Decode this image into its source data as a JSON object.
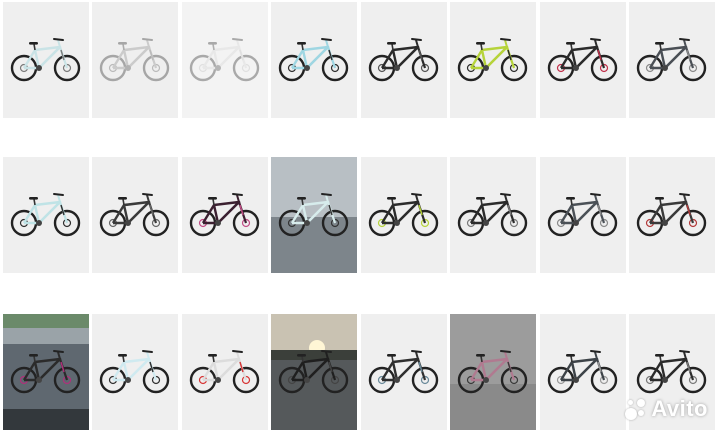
{
  "gallery": {
    "columns": 8,
    "rows": 3,
    "tiles": [
      {
        "bg": "#efefef",
        "frame": "#c9e3e6",
        "accent": "#7a7a7a",
        "faded": false,
        "scene": "studio"
      },
      {
        "bg": "#efefef",
        "frame": "#8a8a8a",
        "accent": "#5a5a5a",
        "faded": true,
        "scene": "studio"
      },
      {
        "bg": "#f3f3f3",
        "frame": "#d6d6d6",
        "accent": "#bdbdbd",
        "faded": true,
        "scene": "studio"
      },
      {
        "bg": "#efefef",
        "frame": "#9fd6e2",
        "accent": "#2f2f2f",
        "faded": false,
        "scene": "studio"
      },
      {
        "bg": "#efefef",
        "frame": "#2b2b2b",
        "accent": "#555555",
        "faded": false,
        "scene": "studio"
      },
      {
        "bg": "#efefef",
        "frame": "#b6d33a",
        "accent": "#2b2b2b",
        "faded": false,
        "scene": "studio"
      },
      {
        "bg": "#efefef",
        "frame": "#2b2b2b",
        "accent": "#c0304a",
        "faded": false,
        "scene": "studio"
      },
      {
        "bg": "#efefef",
        "frame": "#4a4f55",
        "accent": "#8a8a8a",
        "faded": false,
        "scene": "studio"
      },
      {
        "bg": "#efefef",
        "frame": "#bfe3e6",
        "accent": "#2f2f2f",
        "faded": false,
        "scene": "studio"
      },
      {
        "bg": "#efefef",
        "frame": "#3a3a3a",
        "accent": "#666666",
        "faded": false,
        "scene": "studio"
      },
      {
        "bg": "#efefef",
        "frame": "#3b2030",
        "accent": "#c24d86",
        "faded": false,
        "scene": "studio"
      },
      {
        "bg": "#9aa1a6",
        "frame": "#d7ecec",
        "accent": "#333333",
        "faded": false,
        "scene": "road"
      },
      {
        "bg": "#efefef",
        "frame": "#2b2b2b",
        "accent": "#b6d33a",
        "faded": false,
        "scene": "studio"
      },
      {
        "bg": "#efefef",
        "frame": "#2b2b2b",
        "accent": "#7a7a7a",
        "faded": false,
        "scene": "studio"
      },
      {
        "bg": "#efefef",
        "frame": "#4b5157",
        "accent": "#8a8a8a",
        "faded": false,
        "scene": "studio"
      },
      {
        "bg": "#efefef",
        "frame": "#3a3a3a",
        "accent": "#b33a3a",
        "faded": false,
        "scene": "studio"
      },
      {
        "bg": "#6e7c88",
        "frame": "#2b2b2b",
        "accent": "#b0307a",
        "faded": false,
        "scene": "outdoor"
      },
      {
        "bg": "#efefef",
        "frame": "#cfeaf0",
        "accent": "#2f2f2f",
        "faded": false,
        "scene": "studio"
      },
      {
        "bg": "#efefef",
        "frame": "#dcdcdc",
        "accent": "#d73535",
        "faded": false,
        "scene": "studio"
      },
      {
        "bg": "#6f6f6f",
        "frame": "#1f1f1f",
        "accent": "#444444",
        "faded": false,
        "scene": "sunset"
      },
      {
        "bg": "#efefef",
        "frame": "#2f2f2f",
        "accent": "#6a8a9a",
        "faded": false,
        "scene": "studio"
      },
      {
        "bg": "#a0a0a0",
        "frame": "#b07a90",
        "accent": "#3a3a3a",
        "faded": false,
        "scene": "dark"
      },
      {
        "bg": "#efefef",
        "frame": "#3d4348",
        "accent": "#9a9a9a",
        "faded": false,
        "scene": "studio"
      },
      {
        "bg": "#efefef",
        "frame": "#2b2b2b",
        "accent": "#7a7a7a",
        "faded": false,
        "scene": "studio"
      }
    ]
  },
  "watermark": {
    "text": "Avito",
    "dot_colors": [
      "#ffffff",
      "#ffffff",
      "#ffffff",
      "#ffffff"
    ]
  }
}
